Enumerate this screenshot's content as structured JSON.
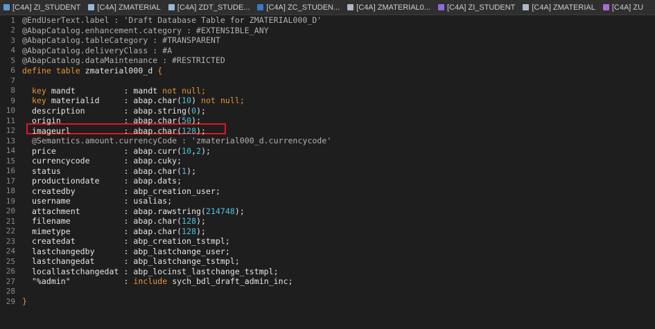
{
  "tabs": [
    {
      "label": "[C4A] ZI_STUDENT",
      "icon": "cds-view-icon",
      "color": "#5b9bd5"
    },
    {
      "label": "[C4A] ZMATERIAL",
      "icon": "table-icon",
      "color": "#9ab7d9"
    },
    {
      "label": "[C4A] ZDT_STUDE...",
      "icon": "table-icon",
      "color": "#9ab7d9"
    },
    {
      "label": "[C4A] ZC_STUDEN...",
      "icon": "cds-view-icon",
      "color": "#3a78c9"
    },
    {
      "label": "[C4A] ZMATERIAL0...",
      "icon": "behavior-icon",
      "color": "#b0b8c4"
    },
    {
      "label": "[C4A] ZI_STUDENT",
      "icon": "behavior-icon",
      "color": "#8f6bd6"
    },
    {
      "label": "[C4A] ZMATERIAL",
      "icon": "behavior-icon",
      "color": "#b0b8c4"
    },
    {
      "label": "[C4A] ZU",
      "icon": "service-icon",
      "color": "#a86bd6"
    }
  ],
  "colors": {
    "annotation": "#b2b2b2",
    "keyword": "#e8943a",
    "number": "#4ec3d8",
    "default": "#e6e6e6",
    "highlight_box": "#e0171b"
  },
  "highlighted_line": 12,
  "code_lines": [
    {
      "n": "1",
      "segs": [
        {
          "t": "@EndUserText.label : 'Draft Database Table for ZMATERIAL000_D'",
          "k": "anno"
        }
      ]
    },
    {
      "n": "2",
      "segs": [
        {
          "t": "@AbapCatalog.enhancement.category : #EXTENSIBLE_ANY",
          "k": "anno"
        }
      ]
    },
    {
      "n": "3",
      "segs": [
        {
          "t": "@AbapCatalog.tableCategory : #TRANSPARENT",
          "k": "anno"
        }
      ]
    },
    {
      "n": "4",
      "segs": [
        {
          "t": "@AbapCatalog.deliveryClass : #A",
          "k": "anno"
        }
      ]
    },
    {
      "n": "5",
      "segs": [
        {
          "t": "@AbapCatalog.dataMaintenance : #RESTRICTED",
          "k": "anno"
        }
      ]
    },
    {
      "n": "6",
      "segs": [
        {
          "t": "define table ",
          "k": "kw"
        },
        {
          "t": "zmaterial000_d ",
          "k": "def"
        },
        {
          "t": "{",
          "k": "kw"
        }
      ]
    },
    {
      "n": "7",
      "segs": []
    },
    {
      "n": "8",
      "segs": [
        {
          "t": "  key ",
          "k": "kw"
        },
        {
          "t": "mandt          : mandt ",
          "k": "def"
        },
        {
          "t": "not null;",
          "k": "kw"
        }
      ]
    },
    {
      "n": "9",
      "segs": [
        {
          "t": "  key ",
          "k": "kw"
        },
        {
          "t": "materialid     : abap.char(",
          "k": "def"
        },
        {
          "t": "10",
          "k": "num"
        },
        {
          "t": ") ",
          "k": "def"
        },
        {
          "t": "not null;",
          "k": "kw"
        }
      ]
    },
    {
      "n": "10",
      "segs": [
        {
          "t": "  description        : abap.string(",
          "k": "def"
        },
        {
          "t": "0",
          "k": "num"
        },
        {
          "t": ");",
          "k": "def"
        }
      ]
    },
    {
      "n": "11",
      "segs": [
        {
          "t": "  origin             : abap.char(",
          "k": "def"
        },
        {
          "t": "50",
          "k": "num"
        },
        {
          "t": ");",
          "k": "def"
        }
      ]
    },
    {
      "n": "12",
      "segs": [
        {
          "t": "  imageurl           : abap.char(",
          "k": "def"
        },
        {
          "t": "128",
          "k": "num"
        },
        {
          "t": ");",
          "k": "def"
        }
      ]
    },
    {
      "n": "13",
      "segs": [
        {
          "t": "  @Semantics.amount.currencyCode : 'zmaterial000_d.currencycode'",
          "k": "anno"
        }
      ]
    },
    {
      "n": "14",
      "segs": [
        {
          "t": "  price              : abap.curr(",
          "k": "def"
        },
        {
          "t": "10",
          "k": "num"
        },
        {
          "t": ",",
          "k": "def"
        },
        {
          "t": "2",
          "k": "num"
        },
        {
          "t": ");",
          "k": "def"
        }
      ]
    },
    {
      "n": "15",
      "segs": [
        {
          "t": "  currencycode       : abap.cuky;",
          "k": "def"
        }
      ]
    },
    {
      "n": "16",
      "segs": [
        {
          "t": "  status             : abap.char(",
          "k": "def"
        },
        {
          "t": "1",
          "k": "num"
        },
        {
          "t": ");",
          "k": "def"
        }
      ]
    },
    {
      "n": "17",
      "segs": [
        {
          "t": "  productiondate     : abap.dats;",
          "k": "def"
        }
      ]
    },
    {
      "n": "18",
      "segs": [
        {
          "t": "  createdby          : abp_creation_user;",
          "k": "def"
        }
      ]
    },
    {
      "n": "19",
      "segs": [
        {
          "t": "  username           : usalias;",
          "k": "def"
        }
      ]
    },
    {
      "n": "20",
      "segs": [
        {
          "t": "  attachment         : abap.rawstring(",
          "k": "def"
        },
        {
          "t": "214748",
          "k": "num"
        },
        {
          "t": ");",
          "k": "def"
        }
      ]
    },
    {
      "n": "21",
      "segs": [
        {
          "t": "  filename           : abap.char(",
          "k": "def"
        },
        {
          "t": "128",
          "k": "num"
        },
        {
          "t": ");",
          "k": "def"
        }
      ]
    },
    {
      "n": "22",
      "segs": [
        {
          "t": "  mimetype           : abap.char(",
          "k": "def"
        },
        {
          "t": "128",
          "k": "num"
        },
        {
          "t": ");",
          "k": "def"
        }
      ]
    },
    {
      "n": "23",
      "segs": [
        {
          "t": "  createdat          : abp_creation_tstmpl;",
          "k": "def"
        }
      ]
    },
    {
      "n": "24",
      "segs": [
        {
          "t": "  lastchangedby      : abp_lastchange_user;",
          "k": "def"
        }
      ]
    },
    {
      "n": "25",
      "segs": [
        {
          "t": "  lastchangedat      : abp_lastchange_tstmpl;",
          "k": "def"
        }
      ]
    },
    {
      "n": "26",
      "segs": [
        {
          "t": "  locallastchangedat : abp_locinst_lastchange_tstmpl;",
          "k": "def"
        }
      ]
    },
    {
      "n": "27",
      "segs": [
        {
          "t": "  \"%admin\"           : ",
          "k": "def"
        },
        {
          "t": "include ",
          "k": "kw"
        },
        {
          "t": "sych_bdl_draft_admin_inc;",
          "k": "def"
        }
      ]
    },
    {
      "n": "28",
      "segs": []
    },
    {
      "n": "29",
      "segs": [
        {
          "t": "}",
          "k": "kw"
        }
      ]
    }
  ]
}
